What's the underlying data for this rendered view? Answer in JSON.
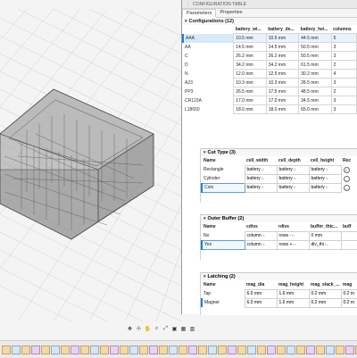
{
  "panel": {
    "title": "CONFIGURATION TABLE",
    "tabs": [
      "Parameters",
      "Properties"
    ],
    "active_tab": "Parameters"
  },
  "configurations": {
    "heading": "Configurations (12)",
    "columns": [
      "battery_wi...",
      "battery_de...",
      "battery_hei...",
      "columns"
    ],
    "rows": [
      {
        "name": "AAA",
        "vals": [
          "10.5 mm",
          "10.5 mm",
          "44.5 mm",
          "5"
        ]
      },
      {
        "name": "AA",
        "vals": [
          "14.5 mm",
          "14.5 mm",
          "50.5 mm",
          "3"
        ]
      },
      {
        "name": "C",
        "vals": [
          "26.2 mm",
          "26.2 mm",
          "50.5 mm",
          "3"
        ]
      },
      {
        "name": "D",
        "vals": [
          "34.2 mm",
          "34.2 mm",
          "61.5 mm",
          "2"
        ]
      },
      {
        "name": "N",
        "vals": [
          "12.0 mm",
          "12.5 mm",
          "30.2 mm",
          "4"
        ]
      },
      {
        "name": "A23",
        "vals": [
          "10.3 mm",
          "10.3 mm",
          "28.5 mm",
          "3"
        ]
      },
      {
        "name": "PP3",
        "vals": [
          "26.5 mm",
          "17.5 mm",
          "48.5 mm",
          "2"
        ]
      },
      {
        "name": "CR123A",
        "vals": [
          "17.0 mm",
          "17.0 mm",
          "34.5 mm",
          "3"
        ]
      },
      {
        "name": "L18650",
        "vals": [
          "18.0 mm",
          "18.0 mm",
          "65.0 mm",
          "3"
        ]
      }
    ]
  },
  "cut_type": {
    "heading": "Cut Type (3)",
    "columns": [
      "Name",
      "cell_width",
      "cell_depth",
      "cell_height",
      "Rec"
    ],
    "rows": [
      {
        "name": "Rectangle",
        "vals": [
          "battery",
          "battery",
          "battery"
        ],
        "mark": "✓"
      },
      {
        "name": "Cylinder",
        "vals": [
          "battery",
          "battery",
          "battery"
        ],
        "mark": "–"
      },
      {
        "name": "Coin",
        "vals": [
          "battery",
          "battery",
          "battery"
        ],
        "mark": "–"
      }
    ]
  },
  "outer_buffer": {
    "heading": "Outer Buffer (2)",
    "columns": [
      "Name",
      "cdivs",
      "rdivs",
      "buffer_thic...",
      "buff"
    ],
    "rows": [
      {
        "name": "No",
        "vals": [
          "column",
          "rows -",
          "0 mm",
          ""
        ]
      },
      {
        "name": "Yes",
        "vals": [
          "column",
          "rows +",
          "div_thi",
          ""
        ]
      }
    ]
  },
  "latching": {
    "heading": "Latching (2)",
    "columns": [
      "Name",
      "mag_dia",
      "mag_height",
      "mag_slack_...",
      "mag"
    ],
    "rows": [
      {
        "name": "Tap",
        "vals": [
          "6.0 mm",
          "1.6 mm",
          "0.2 mm",
          "0.2 m"
        ]
      },
      {
        "name": "Magnet",
        "vals": [
          "6.0 mm",
          "1.6 mm",
          "0.2 mm",
          "0.2 m"
        ]
      }
    ]
  },
  "toolbar_icons": [
    "orbit-icon",
    "pan-icon",
    "look-at-icon",
    "zoom-icon",
    "fit-icon",
    "display-settings-icon",
    "grid-settings-icon",
    "viewports-icon"
  ],
  "fx_label": "fx",
  "colors": {
    "accent": "#1b7fd4",
    "selected_row": "#d7e9f8",
    "model_fill": "#9a9a9a"
  }
}
